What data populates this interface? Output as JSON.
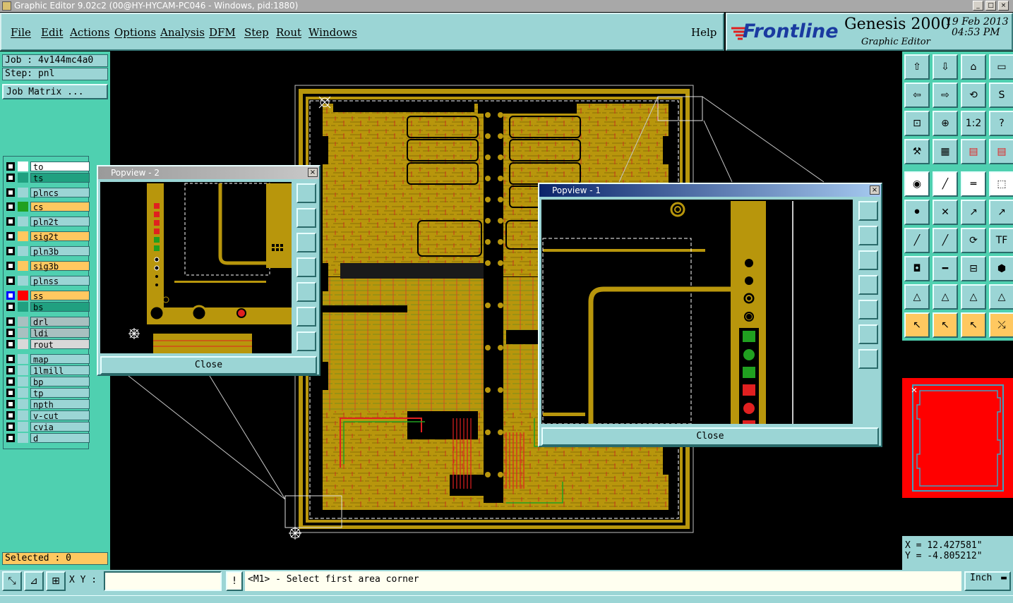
{
  "window": {
    "title": "Graphic Editor 9.02c2 (00@HY-HYCAM-PC046 - Windows, pid:1880)"
  },
  "menu": [
    "File",
    "Edit",
    "Actions",
    "Options",
    "Analysis",
    "DFM",
    "Step",
    "Rout",
    "Windows"
  ],
  "help_label": "Help",
  "brand": {
    "logo": "Frontline",
    "product": "Genesis 2000",
    "subtitle": "Graphic Editor",
    "date": "19 Feb 2013",
    "time": "04:53 PM"
  },
  "job": {
    "label": "Job : 4v144mc4a0",
    "step": "Step: pnl",
    "matrix_button": "Job Matrix ..."
  },
  "layers": [
    {
      "name": "to",
      "bg": "#ffffff",
      "color": "#ffffff",
      "chk_color": ""
    },
    {
      "name": "ts",
      "bg": "#20a080",
      "color": "#20a080",
      "chk_color": ""
    },
    {
      "name": "plncs",
      "bg": "#9bd5d5",
      "color": "#9bd5d5",
      "chk_color": ""
    },
    {
      "name": "cs",
      "bg": "#ffc860",
      "color": "#20a020",
      "chk_color": ""
    },
    {
      "name": "pln2t",
      "bg": "#9bd5d5",
      "color": "#9bd5d5",
      "chk_color": ""
    },
    {
      "name": "sig2t",
      "bg": "#ffc860",
      "color": "#ffc860",
      "chk_color": ""
    },
    {
      "name": "pln3b",
      "bg": "#9bd5d5",
      "color": "#9bd5d5",
      "chk_color": ""
    },
    {
      "name": "sig3b",
      "bg": "#ffc860",
      "color": "#ffc860",
      "chk_color": ""
    },
    {
      "name": "plnss",
      "bg": "#9bd5d5",
      "color": "#9bd5d5",
      "chk_color": ""
    },
    {
      "name": "ss",
      "bg": "#ffc860",
      "color": "#ff0000",
      "chk_color": "#0000ff"
    },
    {
      "name": "bs",
      "bg": "#20a080",
      "color": "#20a080",
      "chk_color": ""
    },
    {
      "name": "drl",
      "bg": "#a8c0c0",
      "color": "#a8c0c0",
      "chk_color": ""
    },
    {
      "name": "ldi",
      "bg": "#a8c0c0",
      "color": "#a8c0c0",
      "chk_color": ""
    },
    {
      "name": "rout",
      "bg": "#d8d8d8",
      "color": "#d8d8d8",
      "chk_color": ""
    },
    {
      "name": "map",
      "bg": "#9bd5d5",
      "color": "#9bd5d5",
      "chk_color": ""
    },
    {
      "name": "1lmill",
      "bg": "#9bd5d5",
      "color": "#9bd5d5",
      "chk_color": ""
    },
    {
      "name": "bp",
      "bg": "#9bd5d5",
      "color": "#9bd5d5",
      "chk_color": ""
    },
    {
      "name": "tp",
      "bg": "#9bd5d5",
      "color": "#9bd5d5",
      "chk_color": ""
    },
    {
      "name": "npth",
      "bg": "#9bd5d5",
      "color": "#9bd5d5",
      "chk_color": ""
    },
    {
      "name": "v-cut",
      "bg": "#9bd5d5",
      "color": "#9bd5d5",
      "chk_color": ""
    },
    {
      "name": "cvia",
      "bg": "#9bd5d5",
      "color": "#9bd5d5",
      "chk_color": ""
    },
    {
      "name": "d",
      "bg": "#9bd5d5",
      "color": "#9bd5d5",
      "chk_color": ""
    }
  ],
  "selected": "Selected : 0",
  "popview1": {
    "title": "Popview - 1",
    "close": "Close"
  },
  "popview2": {
    "title": "Popview - 2",
    "close": "Close"
  },
  "coords": {
    "x": "X = 12.427581\"",
    "y": "Y = -4.805212\""
  },
  "status": {
    "xy_label": "X Y :",
    "xy_value": "",
    "prompt": "<M1> - Select first area corner",
    "units": "Inch"
  },
  "colors": {
    "copper": "#b8960c",
    "panel": "#9bd5d5",
    "panel_green": "#4fd0b0",
    "title_blue": "#0a246a"
  }
}
